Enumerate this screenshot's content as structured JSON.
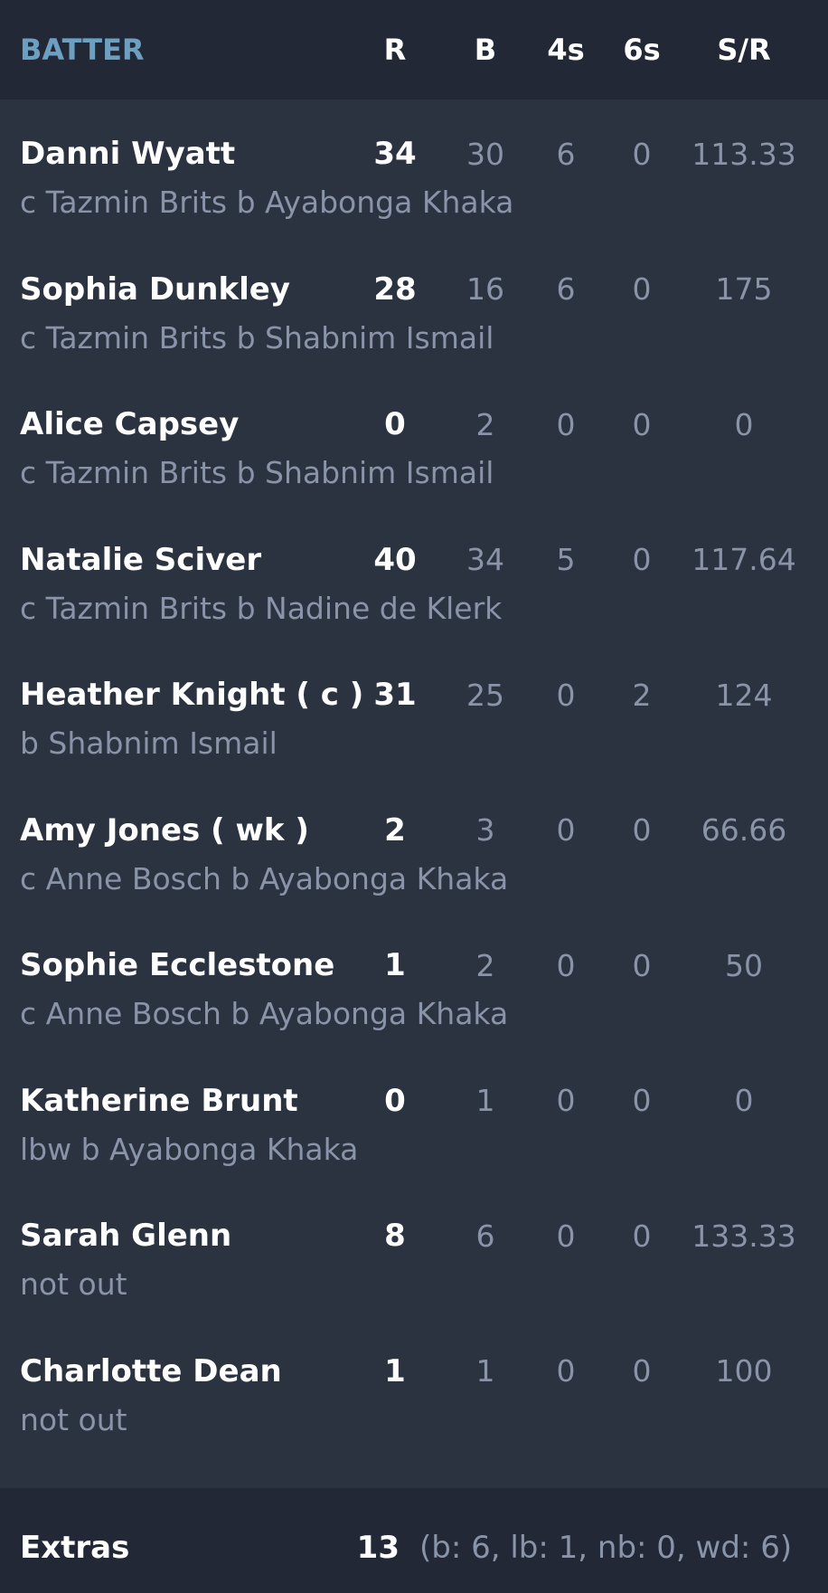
{
  "header": {
    "batter": "BATTER",
    "r": "R",
    "b": "B",
    "fours": "4s",
    "sixes": "6s",
    "sr": "S/R"
  },
  "batters": [
    {
      "name": "Danni Wyatt",
      "dismissal": "c Tazmin Brits b Ayabonga Khaka",
      "r": "34",
      "b": "30",
      "fours": "6",
      "sixes": "0",
      "sr": "113.33"
    },
    {
      "name": "Sophia Dunkley",
      "dismissal": "c Tazmin Brits b Shabnim Ismail",
      "r": "28",
      "b": "16",
      "fours": "6",
      "sixes": "0",
      "sr": "175"
    },
    {
      "name": "Alice Capsey",
      "dismissal": "c Tazmin Brits b Shabnim Ismail",
      "r": "0",
      "b": "2",
      "fours": "0",
      "sixes": "0",
      "sr": "0"
    },
    {
      "name": "Natalie Sciver",
      "dismissal": "c Tazmin Brits b Nadine de Klerk",
      "r": "40",
      "b": "34",
      "fours": "5",
      "sixes": "0",
      "sr": "117.64"
    },
    {
      "name": "Heather Knight ( c )",
      "dismissal": "b Shabnim Ismail",
      "r": "31",
      "b": "25",
      "fours": "0",
      "sixes": "2",
      "sr": "124"
    },
    {
      "name": "Amy Jones ( wk )",
      "dismissal": "c Anne Bosch b Ayabonga Khaka",
      "r": "2",
      "b": "3",
      "fours": "0",
      "sixes": "0",
      "sr": "66.66"
    },
    {
      "name": "Sophie Ecclestone",
      "dismissal": "c Anne Bosch b Ayabonga Khaka",
      "r": "1",
      "b": "2",
      "fours": "0",
      "sixes": "0",
      "sr": "50"
    },
    {
      "name": "Katherine Brunt",
      "dismissal": "lbw b Ayabonga Khaka",
      "r": "0",
      "b": "1",
      "fours": "0",
      "sixes": "0",
      "sr": "0"
    },
    {
      "name": "Sarah Glenn",
      "dismissal": "not out",
      "r": "8",
      "b": "6",
      "fours": "0",
      "sixes": "0",
      "sr": "133.33"
    },
    {
      "name": "Charlotte Dean",
      "dismissal": "not out",
      "r": "1",
      "b": "1",
      "fours": "0",
      "sixes": "0",
      "sr": "100"
    }
  ],
  "extras": {
    "label": "Extras",
    "total": "13",
    "detail": "(b: 6, lb: 1, nb: 0, wd: 6)"
  },
  "colors": {
    "background": "#2b3240",
    "header_background": "#222836",
    "accent": "#6d9fc1",
    "muted_text": "#8a94a8",
    "primary_text": "#ffffff"
  }
}
